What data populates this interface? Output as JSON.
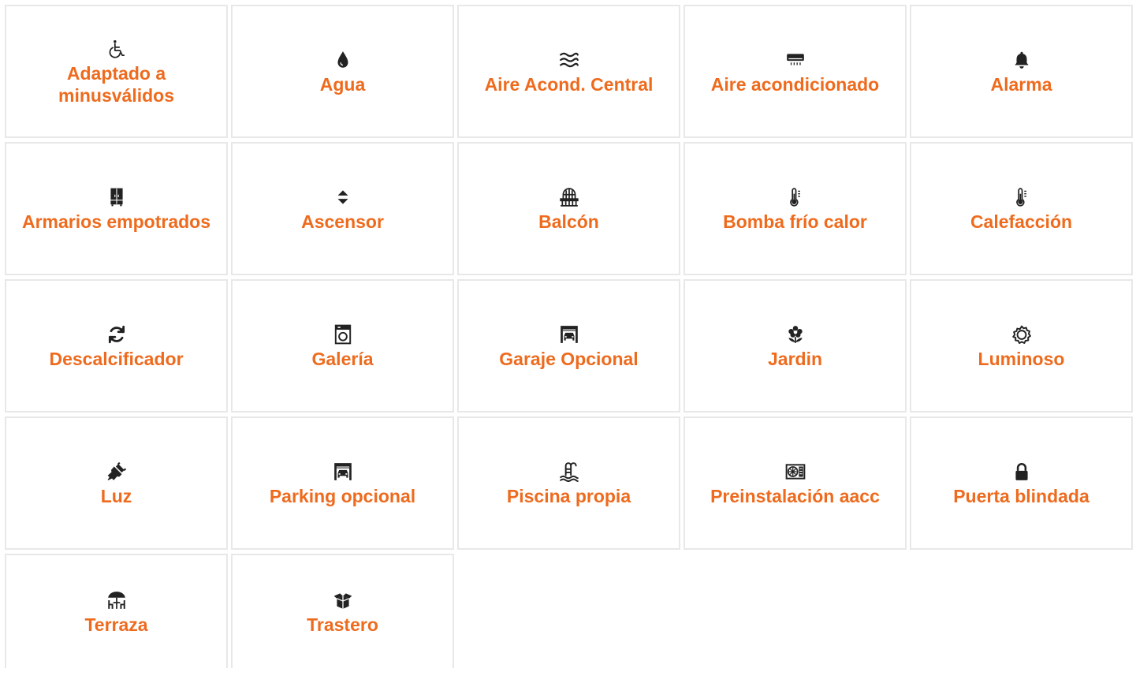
{
  "accent_color": "#ee6b1e",
  "icon_color": "#222222",
  "features": [
    {
      "label": "Adaptado a minusválidos",
      "icon": "wheelchair-icon"
    },
    {
      "label": "Agua",
      "icon": "water-drop-icon"
    },
    {
      "label": "Aire Acond. Central",
      "icon": "waves-icon"
    },
    {
      "label": "Aire acondicionado",
      "icon": "air-conditioner-icon"
    },
    {
      "label": "Alarma",
      "icon": "bell-icon"
    },
    {
      "label": "Armarios empotrados",
      "icon": "wardrobe-icon"
    },
    {
      "label": "Ascensor",
      "icon": "elevator-icon"
    },
    {
      "label": "Balcón",
      "icon": "balcony-icon"
    },
    {
      "label": "Bomba frío calor",
      "icon": "thermometer-icon"
    },
    {
      "label": "Calefacción",
      "icon": "thermometer-icon"
    },
    {
      "label": "Descalcificador",
      "icon": "refresh-icon"
    },
    {
      "label": "Galería",
      "icon": "washing-machine-icon"
    },
    {
      "label": "Garaje Opcional",
      "icon": "garage-icon"
    },
    {
      "label": "Jardin",
      "icon": "flower-icon"
    },
    {
      "label": "Luminoso",
      "icon": "sun-icon"
    },
    {
      "label": "Luz",
      "icon": "plug-icon"
    },
    {
      "label": "Parking opcional",
      "icon": "garage-icon"
    },
    {
      "label": "Piscina propia",
      "icon": "pool-ladder-icon"
    },
    {
      "label": "Preinstalación aacc",
      "icon": "ac-unit-icon"
    },
    {
      "label": "Puerta blindada",
      "icon": "lock-icon"
    },
    {
      "label": "Terraza",
      "icon": "terrace-umbrella-icon"
    },
    {
      "label": "Trastero",
      "icon": "box-icon"
    }
  ]
}
